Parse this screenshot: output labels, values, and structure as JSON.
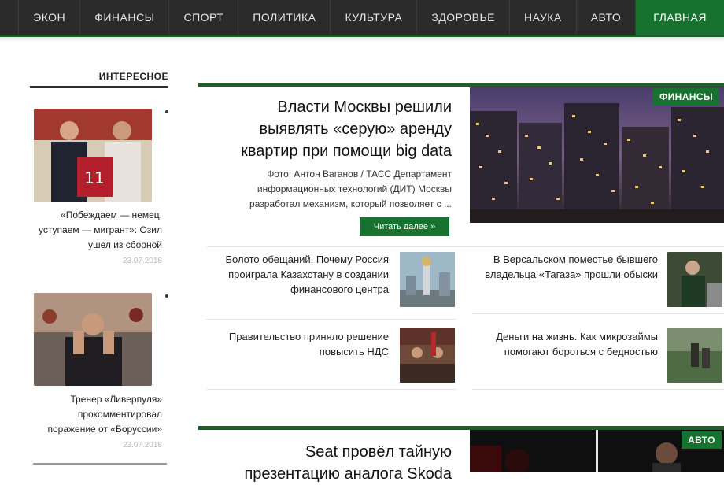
{
  "nav": {
    "items": [
      {
        "label": "ГЛАВНАЯ",
        "active": true
      },
      {
        "label": "АВТО"
      },
      {
        "label": "НАУКА"
      },
      {
        "label": "ЗДОРОВЬЕ"
      },
      {
        "label": "КУЛЬТУРА"
      },
      {
        "label": "ПОЛИТИКА"
      },
      {
        "label": "СПОРТ"
      },
      {
        "label": "ФИНАНСЫ"
      },
      {
        "label": "ЭКОН"
      }
    ]
  },
  "sidebar": {
    "title": "ИНТЕРЕСНОЕ",
    "cards": [
      {
        "text": "«Побеждаем — немец, уступаем — мигрант»: Озил ушел из сборной",
        "date": "23.07.2018"
      },
      {
        "text": "Тренер «Ливерпуля» прокомментировал поражение от «Боруссии»",
        "date": "23.07.2018"
      }
    ]
  },
  "feature": {
    "badge": "ФИНАНСЫ",
    "title": "Власти Москвы решили выявлять «серую» аренду квартир при помощи big data",
    "description": "Фото: Антон Ваганов / ТАСС Департамент информационных технологий (ДИТ) Москвы разработал механизм, который позволяет с ...",
    "read_more": "Читать далее »"
  },
  "news": [
    {
      "text": "В Версальском поместье бывшего владельца «Тагаза» прошли обыски"
    },
    {
      "text": "Болото обещаний. Почему Россия проиграла Казахстану в создании финансового центра"
    },
    {
      "text": "Деньги на жизнь. Как микрозаймы помогают бороться с бедностью"
    },
    {
      "text": "Правительство приняло решение повысить НДС"
    }
  ],
  "second": {
    "badge": "АВТО",
    "title": "Seat провёл тайную презентацию аналога Skoda"
  },
  "colors": {
    "accent": "#16722e",
    "nav_bg": "#2b2b2b"
  }
}
